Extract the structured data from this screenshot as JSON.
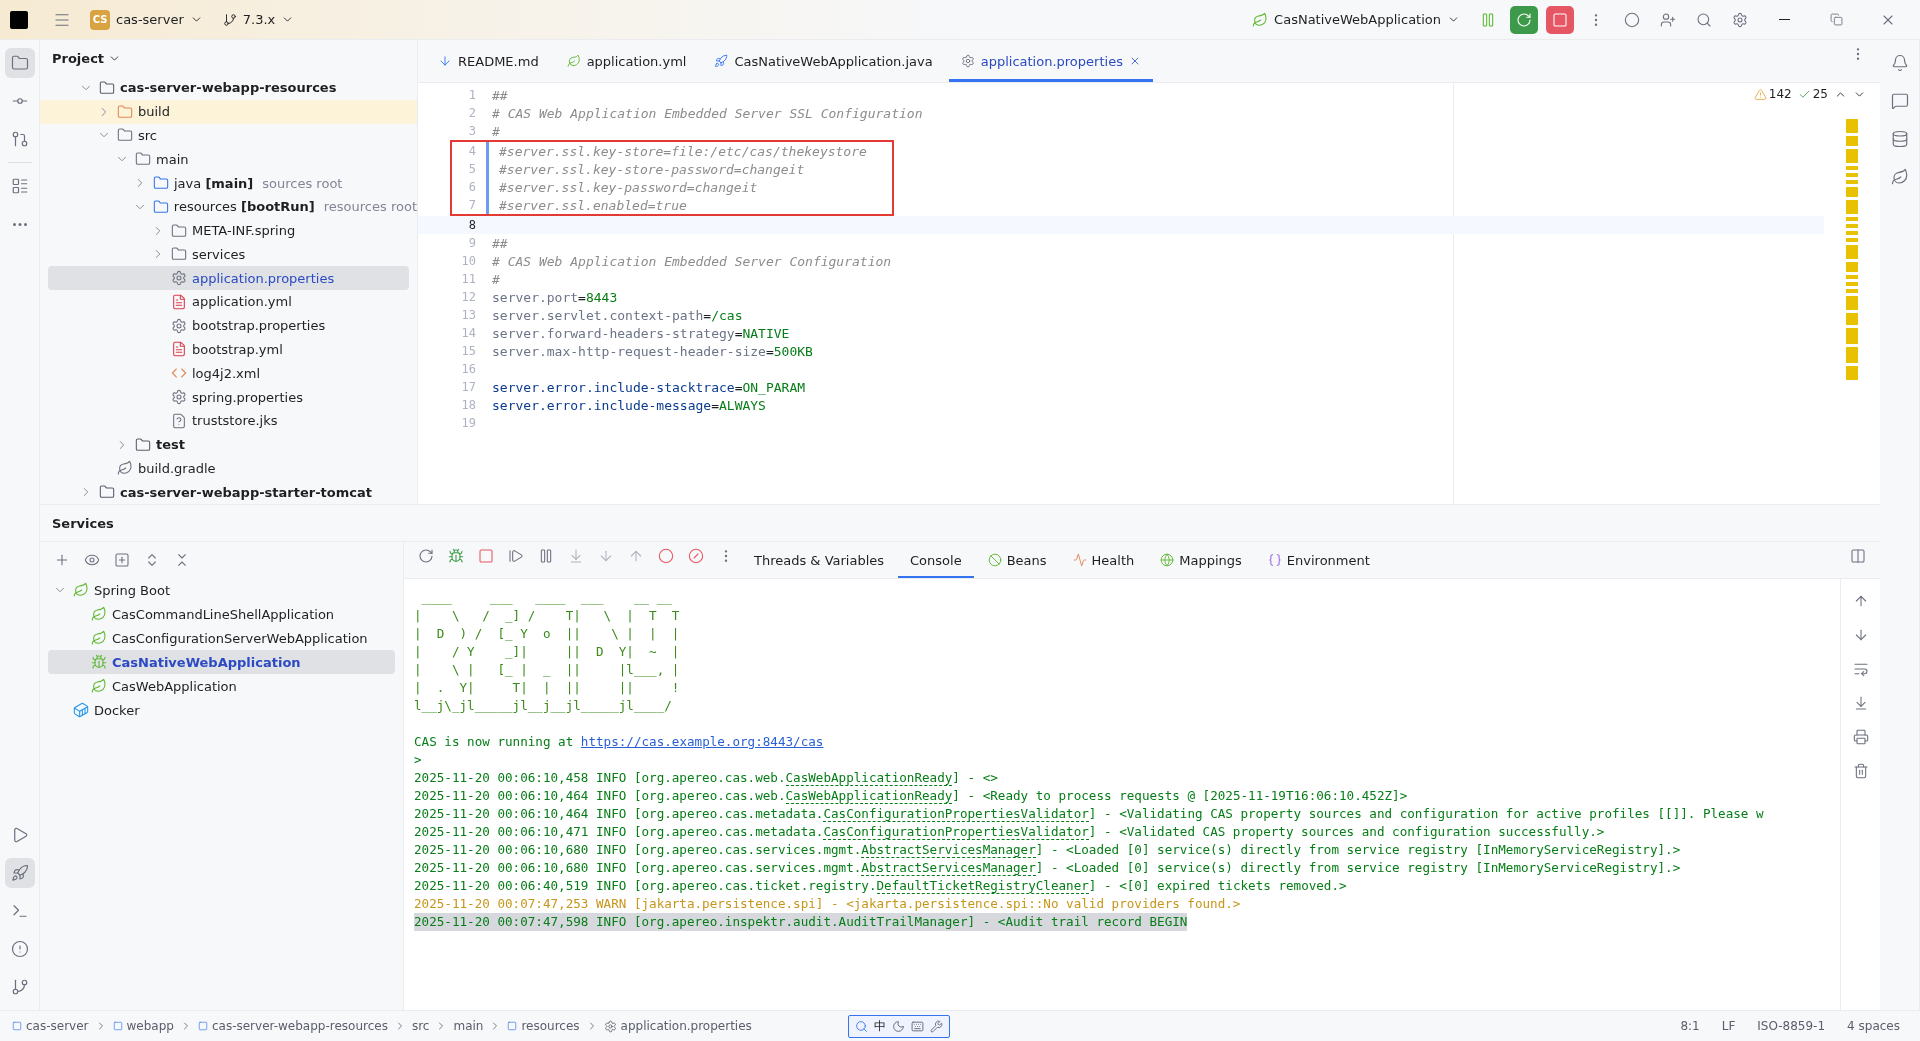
{
  "title_bar": {
    "project_badge": "CS",
    "project": "cas-server",
    "branch": "7.3.x",
    "run_config": "CasNativeWebApplication"
  },
  "project_panel": {
    "title": "Project",
    "tree": [
      {
        "name": "cas-server-webapp-resources",
        "kind": "module",
        "expanded": true,
        "selected": false,
        "children": [
          {
            "name": "build",
            "kind": "folder-excluded",
            "expanded": false,
            "selected": false
          },
          {
            "name": "src",
            "kind": "folder",
            "expanded": true,
            "selected": false,
            "children": [
              {
                "name": "main",
                "kind": "folder",
                "expanded": true,
                "selected": false,
                "children": [
                  {
                    "name": "java **[main]**",
                    "hint": "sources root",
                    "kind": "source-root",
                    "expanded": false,
                    "selected": false
                  },
                  {
                    "name": "resources **[bootRun]**",
                    "hint": "resources root",
                    "kind": "source-root",
                    "expanded": true,
                    "selected": false,
                    "children": [
                      {
                        "name": "META-INF.spring",
                        "kind": "folder",
                        "expanded": false,
                        "selected": false
                      },
                      {
                        "name": "services",
                        "kind": "folder",
                        "expanded": false,
                        "selected": false
                      },
                      {
                        "name": "application.properties",
                        "kind": "properties",
                        "selected": true
                      },
                      {
                        "name": "application.yml",
                        "kind": "yml",
                        "selected": false
                      },
                      {
                        "name": "bootstrap.properties",
                        "kind": "properties",
                        "selected": false
                      },
                      {
                        "name": "bootstrap.yml",
                        "kind": "yml",
                        "selected": false
                      },
                      {
                        "name": "log4j2.xml",
                        "kind": "xml",
                        "selected": false
                      },
                      {
                        "name": "spring.properties",
                        "kind": "properties",
                        "selected": false
                      },
                      {
                        "name": "truststore.jks",
                        "kind": "unknown",
                        "selected": false
                      }
                    ]
                  }
                ]
              },
              {
                "name": "test",
                "kind": "module",
                "expanded": false,
                "selected": false
              }
            ]
          },
          {
            "name": "build.gradle",
            "kind": "gradle",
            "selected": false
          }
        ]
      },
      {
        "name": "cas-server-webapp-starter-tomcat",
        "kind": "module",
        "expanded": false,
        "selected": false
      }
    ]
  },
  "editor": {
    "tabs": [
      {
        "label": "README.md",
        "kind": "md",
        "selected": false
      },
      {
        "label": "application.yml",
        "kind": "yml",
        "selected": false
      },
      {
        "label": "CasNativeWebApplication.java",
        "kind": "java",
        "selected": false
      },
      {
        "label": "application.properties",
        "kind": "properties",
        "selected": true
      }
    ],
    "warnings": "142",
    "typos": "25",
    "lines": [
      {
        "number": "1",
        "boxed": false,
        "current": false,
        "tokens": [
          {
            "text": "##",
            "kind": "comment"
          }
        ]
      },
      {
        "number": "2",
        "boxed": false,
        "current": false,
        "tokens": [
          {
            "text": "# CAS Web Application Embedded Server SSL Configuration",
            "kind": "comment"
          }
        ]
      },
      {
        "number": "3",
        "boxed": false,
        "current": false,
        "tokens": [
          {
            "text": "#",
            "kind": "comment"
          }
        ]
      },
      {
        "number": "4",
        "boxed": true,
        "current": false,
        "tokens": [
          {
            "text": "#server.ssl.key-store=file:/etc/cas/thekeystore",
            "kind": "comment"
          }
        ]
      },
      {
        "number": "5",
        "boxed": true,
        "current": false,
        "tokens": [
          {
            "text": "#server.ssl.key-store-password=changeit",
            "kind": "comment"
          }
        ]
      },
      {
        "number": "6",
        "boxed": true,
        "current": false,
        "tokens": [
          {
            "text": "#server.ssl.key-password=changeit",
            "kind": "comment"
          }
        ]
      },
      {
        "number": "7",
        "boxed": true,
        "current": false,
        "tokens": [
          {
            "text": "#server.ssl.enabled=true",
            "kind": "comment"
          }
        ]
      },
      {
        "number": "8",
        "boxed": false,
        "current": true
      },
      {
        "number": "9",
        "boxed": false,
        "current": false,
        "tokens": [
          {
            "text": "##",
            "kind": "comment"
          }
        ]
      },
      {
        "number": "10",
        "boxed": false,
        "current": false,
        "tokens": [
          {
            "text": "# CAS Web Application Embedded Server Configuration",
            "kind": "comment"
          }
        ]
      },
      {
        "number": "11",
        "boxed": false,
        "current": false,
        "tokens": [
          {
            "text": "#",
            "kind": "comment"
          }
        ]
      },
      {
        "number": "12",
        "boxed": false,
        "current": false,
        "tokens": [
          {
            "text": "server.port",
            "kind": "key"
          },
          {
            "text": "=",
            "kind": "sep"
          },
          {
            "text": "8443",
            "kind": "value"
          }
        ]
      },
      {
        "number": "13",
        "boxed": false,
        "current": false,
        "tokens": [
          {
            "text": "server.servlet.context-path",
            "kind": "key"
          },
          {
            "text": "=",
            "kind": "sep"
          },
          {
            "text": "/cas",
            "kind": "value"
          }
        ]
      },
      {
        "number": "14",
        "boxed": false,
        "current": false,
        "tokens": [
          {
            "text": "server.forward-headers-strategy",
            "kind": "key"
          },
          {
            "text": "=",
            "kind": "sep"
          },
          {
            "text": "NATIVE",
            "kind": "value"
          }
        ]
      },
      {
        "number": "15",
        "boxed": false,
        "current": false,
        "tokens": [
          {
            "text": "server.max-http-request-header-size",
            "kind": "key"
          },
          {
            "text": "=",
            "kind": "sep"
          },
          {
            "text": "500KB",
            "kind": "value"
          }
        ]
      },
      {
        "number": "16",
        "boxed": false,
        "current": false
      },
      {
        "number": "17",
        "boxed": false,
        "current": false,
        "tokens": [
          {
            "text": "server.error.include-stacktrace",
            "kind": "key-known"
          },
          {
            "text": "=",
            "kind": "sep"
          },
          {
            "text": "ON_PARAM",
            "kind": "value"
          }
        ]
      },
      {
        "number": "18",
        "boxed": false,
        "current": false,
        "tokens": [
          {
            "text": "server.error.include-message",
            "kind": "key-known"
          },
          {
            "text": "=",
            "kind": "sep"
          },
          {
            "text": "ALWAYS",
            "kind": "value"
          }
        ]
      },
      {
        "number": "19",
        "boxed": false,
        "current": false
      }
    ]
  },
  "services": {
    "title": "Services",
    "tree": [
      {
        "name": "Spring Boot",
        "kind": "spring",
        "expanded": true,
        "selected": false,
        "children": [
          {
            "name": "CasCommandLineShellApplication",
            "kind": "app",
            "selected": false
          },
          {
            "name": "CasConfigurationServerWebApplication",
            "kind": "app",
            "selected": false
          },
          {
            "name": "CasNativeWebApplication",
            "kind": "app-debugging",
            "selected": true
          },
          {
            "name": "CasWebApplication",
            "kind": "app",
            "selected": false
          }
        ]
      },
      {
        "name": "Docker",
        "kind": "docker",
        "selected": false
      }
    ],
    "tabs": [
      {
        "label": "Threads & Variables",
        "kind": "plain",
        "selected": false
      },
      {
        "label": "Console",
        "kind": "plain",
        "selected": true
      },
      {
        "label": "Beans",
        "kind": "beans",
        "selected": false
      },
      {
        "label": "Health",
        "kind": "health",
        "selected": false
      },
      {
        "label": "Mappings",
        "kind": "mappings",
        "selected": false
      },
      {
        "label": "Environment",
        "kind": "environment",
        "selected": false
      }
    ],
    "console": [
      {
        "kind": "banner",
        "text": " ____     ___   ____  ___    __ __"
      },
      {
        "kind": "banner",
        "text": "|    \\   /  _] /    T|   \\  |  T  T"
      },
      {
        "kind": "banner",
        "text": "|  D  ) /  [_ Y  o  ||    \\ |  |  |"
      },
      {
        "kind": "banner",
        "text": "|    / Y    _]|     ||  D  Y|  ~  |"
      },
      {
        "kind": "banner",
        "text": "|    \\ |   [_ |  _  ||     |l___, |"
      },
      {
        "kind": "banner",
        "text": "|  .  Y|     T|  |  ||     ||     !"
      },
      {
        "kind": "banner",
        "text": "l__j\\_jl_____jl__j__jl_____jl____/"
      },
      {
        "kind": "blank"
      },
      {
        "kind": "link",
        "text": "CAS is now running at ",
        "link": "https://cas.example.org:8443/cas"
      },
      {
        "kind": "plain",
        "text": ">"
      },
      {
        "kind": "info-log",
        "selected": false,
        "head": "2025-11-20 00:06:10,458 INFO [org.apereo.cas.web.",
        "class": "CasWebApplicationReady",
        "tail": "] - <>"
      },
      {
        "kind": "info-log",
        "selected": false,
        "head": "2025-11-20 00:06:10,464 INFO [org.apereo.cas.web.",
        "class": "CasWebApplicationReady",
        "tail": "] - <Ready to process requests @ [2025-11-19T16:06:10.452Z]>"
      },
      {
        "kind": "info-log",
        "selected": false,
        "head": "2025-11-20 00:06:10,464 INFO [org.apereo.cas.metadata.",
        "class": "CasConfigurationPropertiesValidator",
        "tail": "] - <Validating CAS property sources and configuration for active profiles [[]]. Please w"
      },
      {
        "kind": "info-log",
        "selected": false,
        "head": "2025-11-20 00:06:10,471 INFO [org.apereo.cas.metadata.",
        "class": "CasConfigurationPropertiesValidator",
        "tail": "] - <Validated CAS property sources and configuration successfully.>"
      },
      {
        "kind": "info-log",
        "selected": false,
        "head": "2025-11-20 00:06:10,680 INFO [org.apereo.cas.services.mgmt.",
        "class": "AbstractServicesManager",
        "tail": "] - <Loaded [0] service(s) directly from service registry [InMemoryServiceRegistry].>"
      },
      {
        "kind": "info-log",
        "selected": false,
        "head": "2025-11-20 00:06:10,680 INFO [org.apereo.cas.services.mgmt.",
        "class": "AbstractServicesManager",
        "tail": "] - <Loaded [0] service(s) directly from service registry [InMemoryServiceRegistry].>"
      },
      {
        "kind": "info-log",
        "selected": false,
        "head": "2025-11-20 00:06:40,519 INFO [org.apereo.cas.ticket.registry.",
        "class": "DefaultTicketRegistryCleaner",
        "tail": "] - <[0] expired tickets removed.>"
      },
      {
        "kind": "warn-log",
        "selected": false,
        "head": "2025-11-20 00:07:47,253 WARN [jakarta.persistence.spi] - <jakarta.persistence.spi::No valid providers found.>"
      },
      {
        "kind": "info-log",
        "selected": true,
        "head": "2025-11-20 00:07:47,598 INFO [org.apereo.inspektr.audit.AuditTrailManager] - <Audit trail record BEGIN"
      }
    ]
  },
  "status_bar": {
    "breadcrumbs": [
      {
        "label": "cas-server",
        "kind": "module"
      },
      {
        "label": "webapp",
        "kind": "module"
      },
      {
        "label": "cas-server-webapp-resources",
        "kind": "module"
      },
      {
        "label": "src",
        "kind": "folder"
      },
      {
        "label": "main",
        "kind": "folder"
      },
      {
        "label": "resources",
        "kind": "module"
      },
      {
        "label": "application.properties",
        "kind": "properties"
      }
    ],
    "ime": "中",
    "position": "8:1",
    "line_ending": "LF",
    "encoding": "ISO-8859-1",
    "indent": "4 spaces"
  }
}
